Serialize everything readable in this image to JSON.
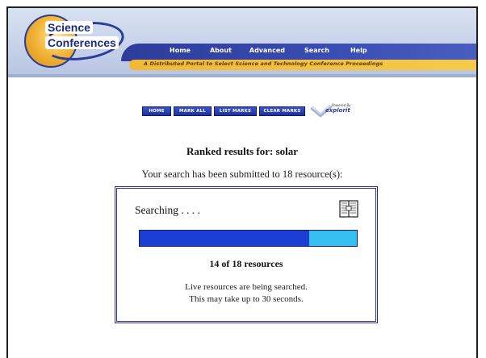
{
  "logo": {
    "line1": "Science",
    "line2": "Conferences"
  },
  "nav": {
    "items": [
      "Home",
      "About",
      "Advanced",
      "Search",
      "Help"
    ]
  },
  "tagline": "A Distributed Portal to Select Science and Technology Conference Proceedings",
  "toolbar": {
    "home": "HOME",
    "mark_all": "MARK ALL",
    "list_marks": "LIST MARKS",
    "clear_marks": "CLEAR MARKS",
    "powered_small": "Powered By",
    "powered_word": "explorit"
  },
  "results": {
    "heading": "Ranked results for: solar",
    "submitted": "Your search has been submitted to 18 resource(s):"
  },
  "status": {
    "label": "Searching . . . .",
    "completed": 14,
    "total": 18,
    "progress_fraction": 0.78,
    "count_text": "14 of 18 resources",
    "line1": "Live resources are being searched.",
    "line2": "This may take up to 30 seconds."
  },
  "colors": {
    "brand_blue": "#2d3c99",
    "progress_done": "#1b3fd6",
    "progress_remaining": "#34bff0",
    "tagline_bar": "#f1b936"
  },
  "icons": {
    "book": "book-icon"
  }
}
